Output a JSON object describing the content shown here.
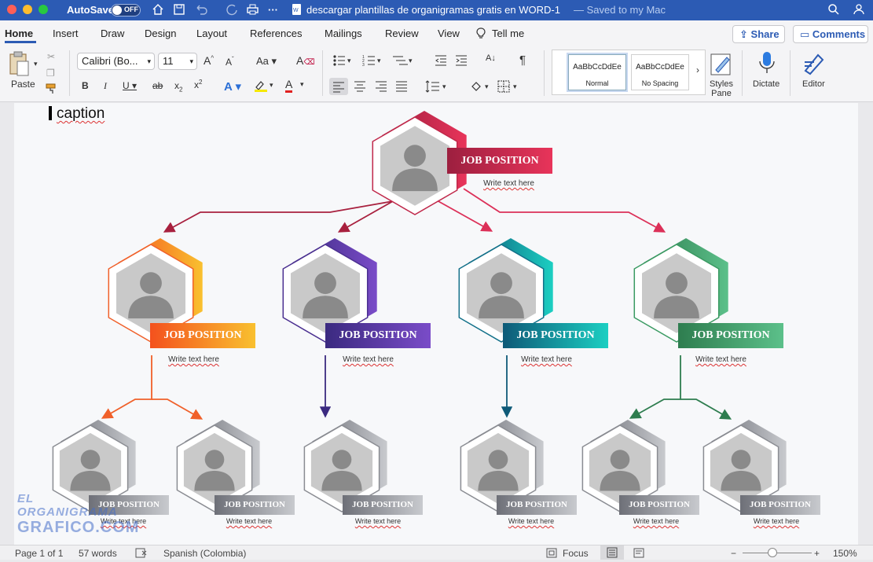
{
  "titlebar": {
    "autosave_label": "AutoSave",
    "autosave_state": "OFF",
    "doc_title": "descargar plantillas de organigramas gratis en WORD-1",
    "save_status": "— Saved to my Mac"
  },
  "tabs": [
    "Home",
    "Insert",
    "Draw",
    "Design",
    "Layout",
    "References",
    "Mailings",
    "Review",
    "View"
  ],
  "tell_me": "Tell me",
  "share_label": "Share",
  "comments_label": "Comments",
  "ribbon": {
    "paste_label": "Paste",
    "font_name": "Calibri (Bo...",
    "font_size": "11",
    "styles": [
      {
        "sample": "AaBbCcDdEe",
        "name": "Normal"
      },
      {
        "sample": "AaBbCcDdEe",
        "name": "No Spacing"
      }
    ],
    "styles_pane_label": "Styles Pane",
    "dictate_label": "Dictate",
    "editor_label": "Editor"
  },
  "document": {
    "caption": "caption",
    "top": {
      "title": "JOB POSITION",
      "subtitle": "Write text here",
      "color_a": "#9c1f3f",
      "color_b": "#e8345a"
    },
    "level2": [
      {
        "title": "JOB POSITION",
        "subtitle": "Write text here",
        "color_a": "#f4511e",
        "color_b": "#f9c02f"
      },
      {
        "title": "JOB POSITION",
        "subtitle": "Write text here",
        "color_a": "#3b2a80",
        "color_b": "#7a4cc8"
      },
      {
        "title": "JOB POSITION",
        "subtitle": "Write text here",
        "color_a": "#0e5a78",
        "color_b": "#1ccfc2"
      },
      {
        "title": "JOB POSITION",
        "subtitle": "Write text here",
        "color_a": "#2e7d4f",
        "color_b": "#5cc08a"
      }
    ],
    "level3": [
      {
        "title": "JOB POSITION",
        "subtitle": "Write text here"
      },
      {
        "title": "JOB POSITION",
        "subtitle": "Write text here"
      },
      {
        "title": "JOB POSITION",
        "subtitle": "Write text here"
      },
      {
        "title": "JOB POSITION",
        "subtitle": "Write text here"
      },
      {
        "title": "JOB POSITION",
        "subtitle": "Write text here"
      },
      {
        "title": "JOB POSITION",
        "subtitle": "Write text here"
      }
    ],
    "watermark_line1": "EL ORGANIGRAMA",
    "watermark_line2": "GRAFICO.COM"
  },
  "statusbar": {
    "page": "Page 1 of 1",
    "words": "57 words",
    "language": "Spanish (Colombia)",
    "focus": "Focus",
    "zoom": "150%"
  }
}
